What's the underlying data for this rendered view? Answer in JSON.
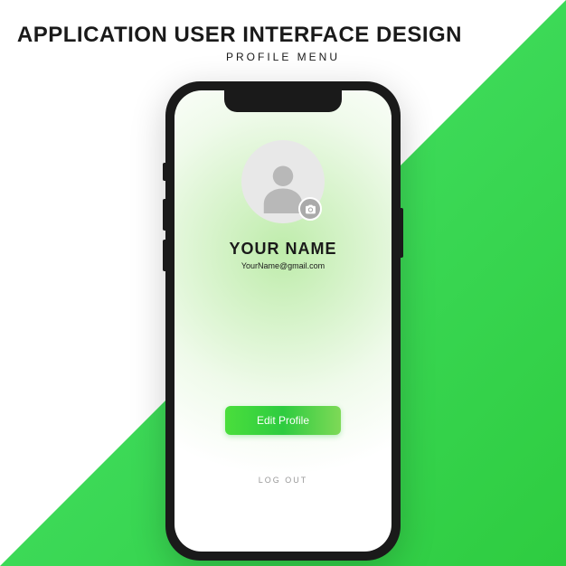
{
  "header": {
    "title": "APPLICATION USER INTERFACE DESIGN",
    "subtitle": "PROFILE MENU"
  },
  "profile": {
    "name": "YOUR NAME",
    "email": "YourName@gmail.com",
    "edit_button_label": "Edit Profile",
    "logout_label": "LOG OUT"
  },
  "icons": {
    "avatar": "person-silhouette-icon",
    "camera": "camera-icon"
  },
  "colors": {
    "accent_green_light": "#7ed957",
    "accent_green": "#2ecc40",
    "phone_frame": "#1a1a1a"
  }
}
